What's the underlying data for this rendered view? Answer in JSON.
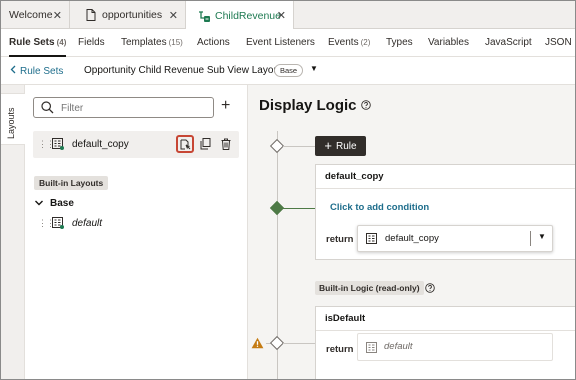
{
  "tabs": [
    {
      "label": "Welcome",
      "icon": "none",
      "active": false
    },
    {
      "label": "opportunities",
      "icon": "file-icon",
      "active": false
    },
    {
      "label": "ChildRevenue",
      "icon": "layout-flow-icon",
      "active": true
    }
  ],
  "subnav": [
    {
      "label": "Rule Sets",
      "count": "(4)",
      "active": true
    },
    {
      "label": "Fields",
      "count": "",
      "active": false
    },
    {
      "label": "Templates",
      "count": "(15)",
      "active": false
    },
    {
      "label": "Actions",
      "count": "",
      "active": false
    },
    {
      "label": "Event Listeners",
      "count": "",
      "active": false
    },
    {
      "label": "Events",
      "count": "(2)",
      "active": false
    },
    {
      "label": "Types",
      "count": "",
      "active": false
    },
    {
      "label": "Variables",
      "count": "",
      "active": false
    },
    {
      "label": "JavaScript",
      "count": "",
      "active": false
    },
    {
      "label": "JSON",
      "count": "",
      "active": false
    }
  ],
  "breadcrumb": {
    "back_label": "Rule Sets",
    "title": "Opportunity Child Revenue Sub View Layout",
    "pill": "Base"
  },
  "rail": {
    "label": "Layouts"
  },
  "left_panel": {
    "filter_placeholder": "Filter",
    "selected_layout": "default_copy",
    "builtin_heading": "Built-in Layouts",
    "group_label": "Base",
    "builtin_layout": "default"
  },
  "main": {
    "heading": "Display Logic",
    "rule_button": "Rule",
    "rule_card": {
      "title": "default_copy",
      "add_condition": "Click to add condition",
      "return_label": "return",
      "return_value": "default_copy"
    },
    "builtin_badge": "Built-in Logic (read-only)",
    "builtin_card": {
      "title": "isDefault",
      "return_label": "return",
      "return_value": "default"
    }
  },
  "colors": {
    "accent_green": "#1e7a52",
    "link_blue": "#1f6e8c",
    "highlight_red": "#c74634",
    "warning_orange": "#c57b12"
  }
}
